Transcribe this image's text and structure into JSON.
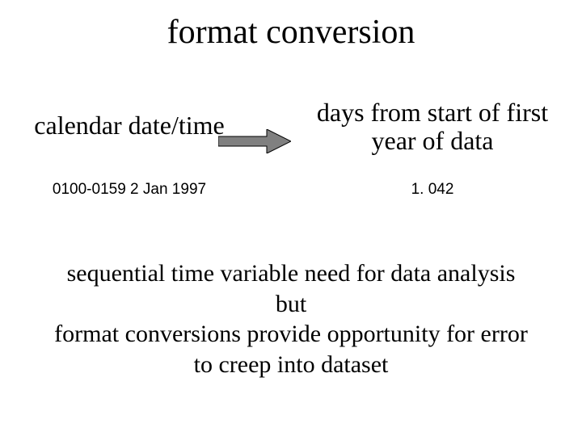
{
  "title": "format conversion",
  "left": {
    "label": "calendar date/time",
    "example": "0100-0159 2 Jan 1997"
  },
  "right": {
    "label": "days from start of first year of data",
    "example": "1. 042"
  },
  "arrow": {
    "fill": "#808080",
    "stroke": "#000000"
  },
  "bottom": {
    "line1": "sequential time variable need for data analysis",
    "line2": "but",
    "line3": "format conversions provide opportunity for error",
    "line4": "to creep into dataset"
  }
}
